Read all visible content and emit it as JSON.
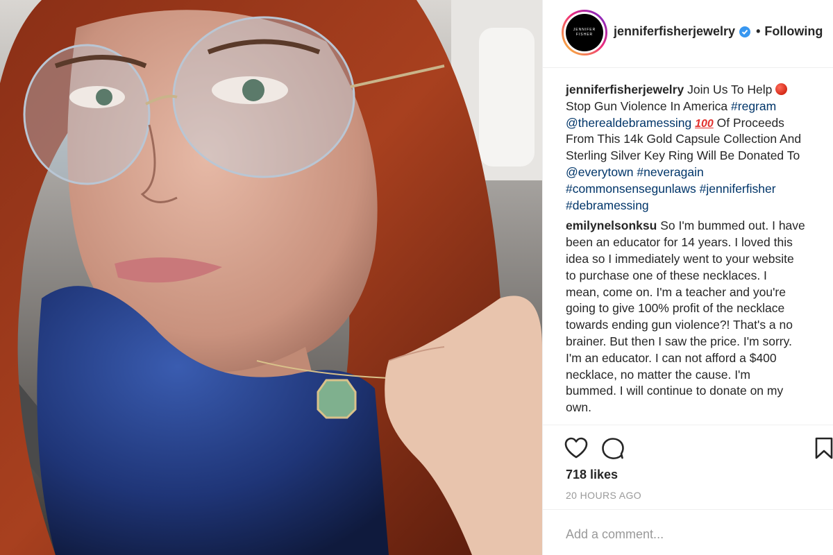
{
  "post": {
    "photo_alt": "photo",
    "account": {
      "username": "jenniferfisherjewelry",
      "avatar_line1": "JENNIFER",
      "avatar_line2": "FISHER",
      "separator": "•",
      "follow_status": "Following"
    },
    "caption": {
      "username": "jenniferfisherjewelry",
      "l1_text": "Join Us To Help",
      "l2_text": "Stop Gun Violence In America",
      "l2_tag": "#regram",
      "l3_mention": "@therealdebramessing",
      "l3_emoji": "100",
      "l3_text": "Of Proceeds",
      "l4_text": "From This 14k Gold Capsule Collection And",
      "l5_text": "Sterling Silver Key Ring Will Be Donated To",
      "l6_mention": "@everytown",
      "l6_tag": "#neveragain",
      "l7_tag1": "#commonsensegunlaws",
      "l7_tag2": "#jenniferfisher",
      "l8_tag": "#debramessing"
    },
    "comment": {
      "username": "emilynelsonksu",
      "l1_text": "So I'm bummed out. I have",
      "lines": [
        "been an educator for 14 years. I loved this",
        "idea so I immediately went to your website",
        "to purchase one of these necklaces. I",
        "mean, come on. I'm a teacher and you're",
        "going to give 100% profit of the necklace",
        "towards ending gun violence?! That's a no",
        "brainer. But then I saw the price. I'm sorry.",
        "I'm an educator. I can not afford a $400",
        "necklace, no matter the cause. I'm",
        "bummed. I will continue to donate on my",
        "own."
      ]
    },
    "likes": "718 likes",
    "timestamp": "20 HOURS AGO",
    "add_comment_placeholder": "Add a comment..."
  },
  "icons": {
    "like": "heart-icon",
    "comment": "comment-bubble-icon",
    "save": "bookmark-icon",
    "verified": "verified-badge-icon"
  },
  "colors": {
    "hashtag": "#003569",
    "verified": "#3897f0",
    "muted": "#999999",
    "text": "#262626"
  }
}
